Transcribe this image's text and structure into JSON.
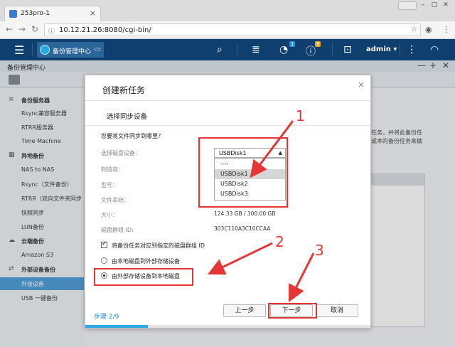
{
  "browser": {
    "tab_title": "253pro-1",
    "tab_close": "×",
    "url": "10.12.21.26:8080/cgi-bin/",
    "window_controls": [
      "–",
      "□",
      "✕"
    ]
  },
  "app": {
    "tab_label": "备份管理中心",
    "user_label": "admin ▾",
    "badge_notify": "1",
    "badge_info": "9"
  },
  "window": {
    "title": "备份管理中心",
    "controls": [
      "—",
      "+",
      "✕"
    ]
  },
  "sidebar": {
    "items": [
      {
        "label": "备份服务器",
        "type": "section",
        "icon": "≡"
      },
      {
        "label": "Rsync兼容服务器",
        "type": "item"
      },
      {
        "label": "RTRR服务器",
        "type": "item"
      },
      {
        "label": "Time Machine",
        "type": "item"
      },
      {
        "label": "异地备份",
        "type": "section",
        "icon": "▦"
      },
      {
        "label": "NAS to NAS",
        "type": "item"
      },
      {
        "label": "Rsync（文件备份）",
        "type": "item"
      },
      {
        "label": "RTRR（双向文件夹同步",
        "type": "item"
      },
      {
        "label": "快照同步",
        "type": "item"
      },
      {
        "label": "LUN备份",
        "type": "item"
      },
      {
        "label": "云端备份",
        "type": "section",
        "icon": "☁"
      },
      {
        "label": "Amazon S3",
        "type": "item"
      },
      {
        "label": "外部设备备份",
        "type": "section",
        "icon": "⇄"
      },
      {
        "label": "外接设备",
        "type": "item",
        "active": true
      },
      {
        "label": "USB 一键备份",
        "type": "item"
      }
    ]
  },
  "background": {
    "text_line1": "任务，并将此备份任",
    "text_line2": "或本的备份任务来做"
  },
  "modal": {
    "title": "创建新任务",
    "close": "×",
    "section_title": "选择同步设备",
    "question": "您要将文件同步到哪里？",
    "fields": {
      "device_label": "选择磁盘设备：",
      "vendor_label": "制造商：",
      "model_label": "型号：",
      "filesystem_label": "文件系统：",
      "size_label": "大小：",
      "size_value": "124.33 GB / 300.00 GB",
      "volume_id_label": "磁盘群组 ID:",
      "volume_id_value": "303C110A3C10CCAA"
    },
    "select": {
      "value": "USBDisk1",
      "arrow": "▲",
      "options": [
        "----",
        "USBDisk1",
        "USBDisk2",
        "USBDisk3"
      ],
      "highlighted": "USBDisk1"
    },
    "checkbox_label": "将备份任务对应到指定的磁盘群组 ID",
    "checkbox_checked": true,
    "radio_options": [
      "由本地磁盘到外部存储设备",
      "由外部存储设备到本地磁盘"
    ],
    "radio_selected": 1,
    "step": "步骤 2/9",
    "buttons": {
      "back": "上一步",
      "next": "下一步",
      "cancel": "取消"
    },
    "progress": 0.22
  },
  "annotations": {
    "num1": "1",
    "num2": "2",
    "num3": "3",
    "color": "#e63535"
  }
}
